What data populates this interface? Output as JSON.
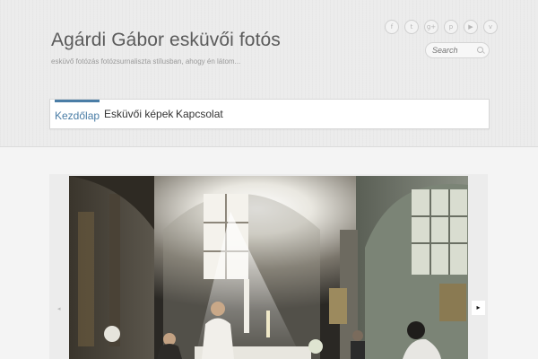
{
  "site": {
    "title": "Agárdi Gábor esküvői fotós",
    "tagline": "esküvő fotózás fotózsurnaliszta stílusban, ahogy én látom..."
  },
  "social_icons": [
    {
      "name": "facebook-icon",
      "glyph": "f"
    },
    {
      "name": "twitter-icon",
      "glyph": "t"
    },
    {
      "name": "google-plus-icon",
      "glyph": "g+"
    },
    {
      "name": "pinterest-icon",
      "glyph": "p"
    },
    {
      "name": "youtube-icon",
      "glyph": "▶"
    },
    {
      "name": "vimeo-icon",
      "glyph": "v"
    }
  ],
  "search": {
    "placeholder": "Search"
  },
  "nav": {
    "items": [
      {
        "label": "Kezdőlap",
        "active": true
      },
      {
        "label": "Esküvői képek",
        "active": false
      },
      {
        "label": "Kapcsolat",
        "active": false
      }
    ]
  },
  "slider": {
    "prev_glyph": "◂",
    "next_glyph": "▸",
    "image": "church-wedding-ceremony-photo"
  },
  "colors": {
    "accent": "#4a7da6",
    "header_bg": "#ececec",
    "page_bg": "#f4f4f4"
  }
}
